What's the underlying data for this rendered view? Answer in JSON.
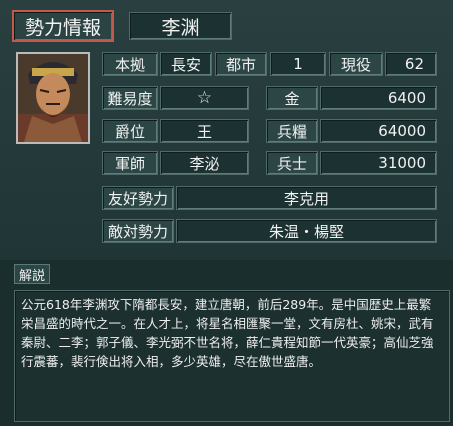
{
  "header": {
    "title": "勢力情報",
    "ruler_name": "李渊"
  },
  "portrait": {
    "subject": "ruler-portrait"
  },
  "row1": {
    "base_label": "本拠",
    "base_value": "長安",
    "cities_label": "都市",
    "cities_value": "1",
    "officers_label": "現役",
    "officers_value": "62"
  },
  "stats": {
    "difficulty_label": "難易度",
    "difficulty_value": "☆",
    "gold_label": "金",
    "gold_value": "6400",
    "rank_label": "爵位",
    "rank_value": "王",
    "food_label": "兵糧",
    "food_value": "64000",
    "strategist_label": "軍師",
    "strategist_value": "李泌",
    "soldiers_label": "兵士",
    "soldiers_value": "31000"
  },
  "relations": {
    "ally_label": "友好勢力",
    "ally_value": "李克用",
    "enemy_label": "敵対勢力",
    "enemy_value": "朱温・楊堅"
  },
  "description": {
    "label": "解説",
    "text": "公元618年李渊攻下隋都長安，建立唐朝，前后289年。是中国歴史上最繁栄昌盛的時代之一。在人才上，将星名相匯聚一堂，文有房杜、姚宋，武有秦尉、二李；郭子儀、李光弼不世名将，薛仁貴程知節一代英豪；高仙芝強行震蕃，裴行倹出将入相，多少英雄，尽在傲世盛唐。"
  }
}
